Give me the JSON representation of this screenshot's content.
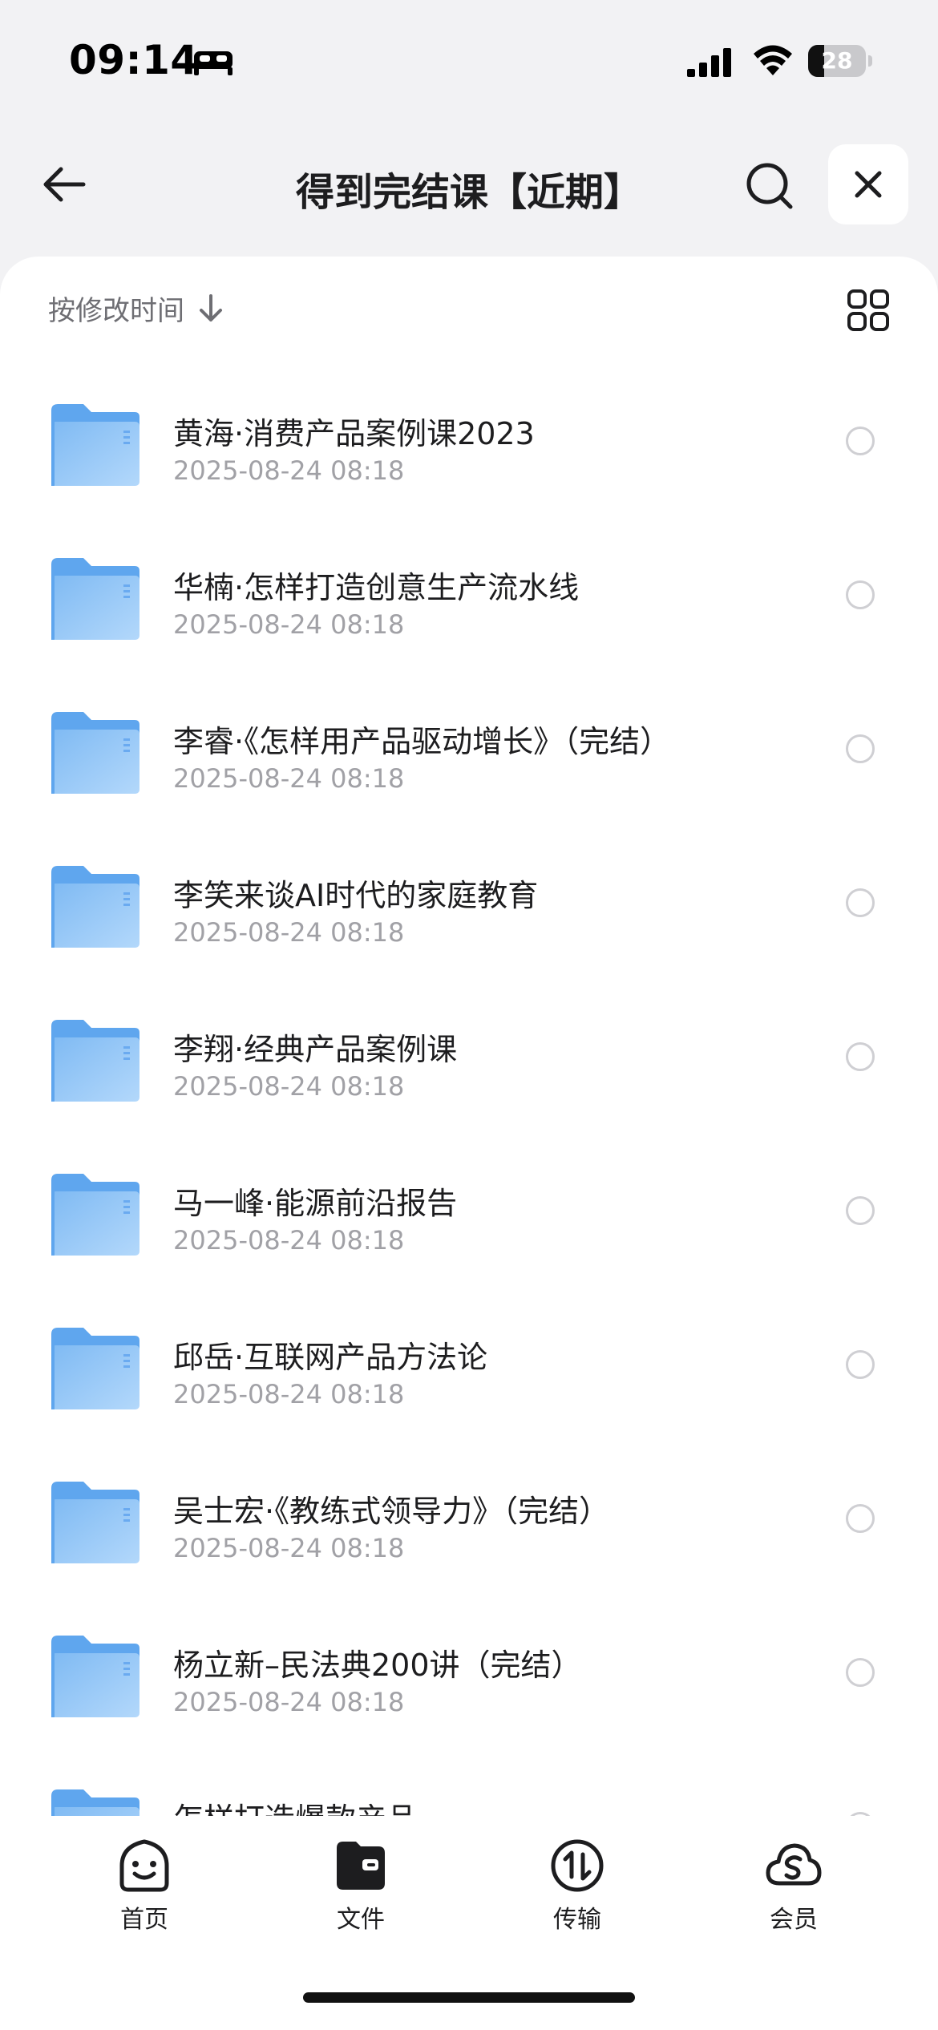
{
  "status_bar": {
    "time": "09:14",
    "focus_icon": "sleep-bed-icon",
    "signal_icon": "cellular-signal-icon",
    "wifi_icon": "wifi-icon",
    "battery_level": "28",
    "battery_fraction": 0.28
  },
  "header": {
    "title": "得到完结课【近期】",
    "back_icon": "arrow-left-icon",
    "search_icon": "search-icon",
    "close_icon": "close-icon"
  },
  "sort": {
    "label": "按修改时间",
    "direction_icon": "arrow-down-icon",
    "view_icon": "grid-view-icon"
  },
  "files": [
    {
      "name": "黄海·消费产品案例课2023",
      "date": "2025-08-24 08:18"
    },
    {
      "name": "华楠·怎样打造创意生产流水线",
      "date": "2025-08-24 08:18"
    },
    {
      "name": "李睿·《怎样用产品驱动增长》（完结）",
      "date": "2025-08-24 08:18"
    },
    {
      "name": "李笑来谈AI时代的家庭教育",
      "date": "2025-08-24 08:18"
    },
    {
      "name": "李翔·经典产品案例课",
      "date": "2025-08-24 08:18"
    },
    {
      "name": "马一峰·能源前沿报告",
      "date": "2025-08-24 08:18"
    },
    {
      "name": "邱岳·互联网产品方法论",
      "date": "2025-08-24 08:18"
    },
    {
      "name": "吴士宏·《教练式领导力》（完结）",
      "date": "2025-08-24 08:18"
    },
    {
      "name": "杨立新–民法典200讲（完结）",
      "date": "2025-08-24 08:18"
    },
    {
      "name": "怎样打造爆款产品",
      "date": ""
    }
  ],
  "tabs": [
    {
      "label": "首页",
      "icon": "smiley-home-icon"
    },
    {
      "label": "文件",
      "icon": "folder-file-icon"
    },
    {
      "label": "传输",
      "icon": "transfer-arrows-icon"
    },
    {
      "label": "会员",
      "icon": "cloud-member-icon"
    }
  ],
  "colors": {
    "background": "#f2f2f4",
    "folder": "#8ec3f5",
    "text_primary": "#1d1d1f",
    "text_secondary": "#a1a1a6"
  }
}
